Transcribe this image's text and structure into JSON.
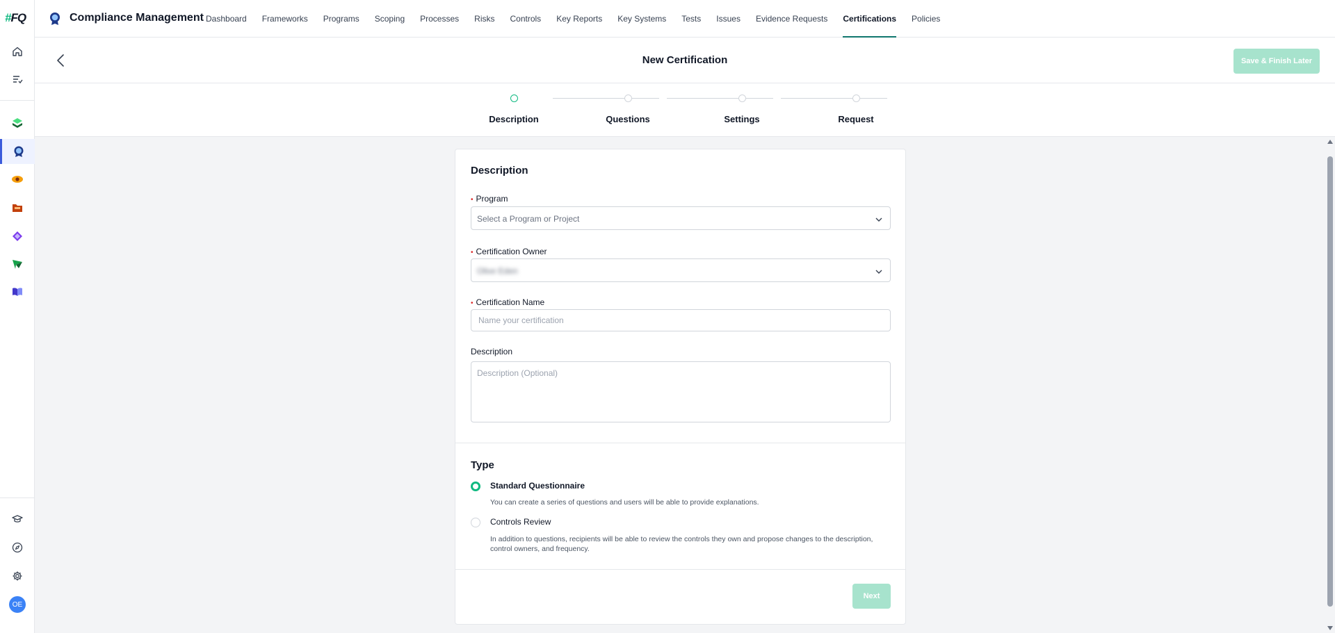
{
  "rail": {
    "logo_hash": "#",
    "logo_text": "FQ",
    "avatar_initials": "OE"
  },
  "header": {
    "app_title": "Compliance Management",
    "nav": [
      "Dashboard",
      "Frameworks",
      "Programs",
      "Scoping",
      "Processes",
      "Risks",
      "Controls",
      "Key Reports",
      "Key Systems",
      "Tests",
      "Issues",
      "Evidence Requests",
      "Certifications",
      "Policies"
    ],
    "active_nav": "Certifications"
  },
  "page": {
    "title": "New Certification",
    "save_label": "Save & Finish Later"
  },
  "stepper": {
    "steps": [
      "Description",
      "Questions",
      "Settings",
      "Request"
    ],
    "current": "Description"
  },
  "form": {
    "section_title": "Description",
    "program": {
      "label": "Program",
      "placeholder": "Select a Program or Project"
    },
    "owner": {
      "label": "Certification Owner",
      "value": "Olive Eden"
    },
    "name": {
      "label": "Certification Name",
      "placeholder": "Name your certification"
    },
    "description": {
      "label": "Description",
      "placeholder": "Description (Optional)"
    }
  },
  "type": {
    "title": "Type",
    "options": [
      {
        "label": "Standard Questionnaire",
        "desc": "You can create a series of questions and users will be able to provide explanations.",
        "selected": true
      },
      {
        "label": "Controls Review",
        "desc": "In addition to questions, recipients will be able to review the controls they own and propose changes to the description, control owners, and frequency.",
        "selected": false
      }
    ]
  },
  "footer": {
    "next_label": "Next"
  },
  "colors": {
    "accent": "#10b981",
    "accent_disabled": "#a7e3cd",
    "nav_underline": "#0f766e"
  }
}
